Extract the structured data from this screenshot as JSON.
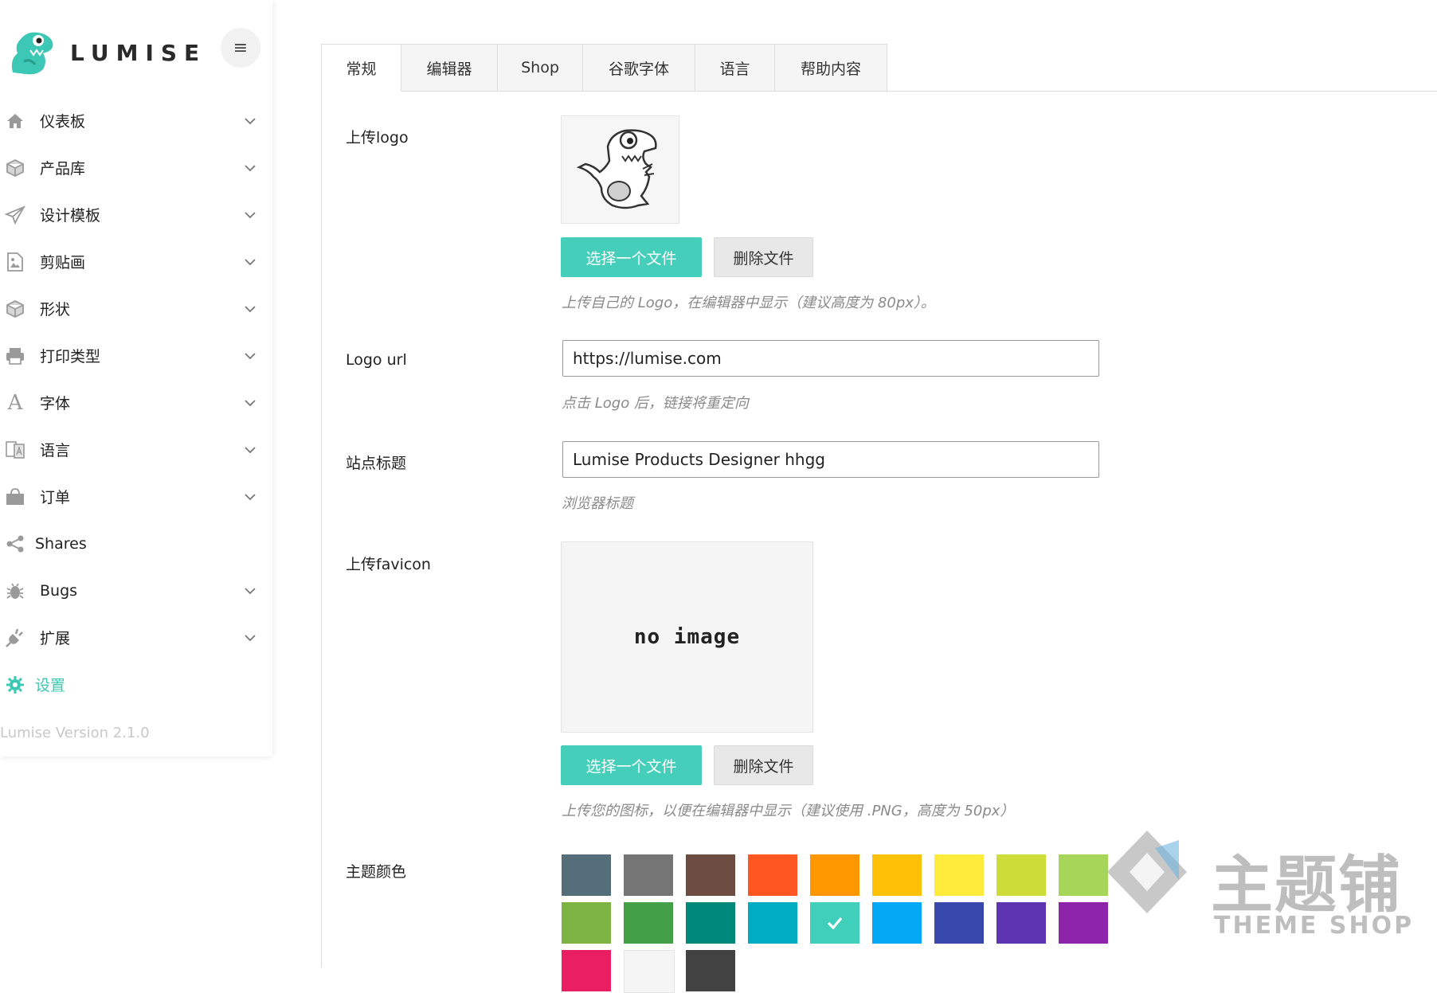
{
  "brand": {
    "name": "LUMISE"
  },
  "sidebar": {
    "items": [
      {
        "label": "仪表板",
        "icon": "home-icon",
        "chevron": true
      },
      {
        "label": "产品库",
        "icon": "cube-icon",
        "chevron": true
      },
      {
        "label": "设计模板",
        "icon": "paper-plane-icon",
        "chevron": true
      },
      {
        "label": "剪贴画",
        "icon": "image-file-icon",
        "chevron": true
      },
      {
        "label": "形状",
        "icon": "cube-icon",
        "chevron": true
      },
      {
        "label": "打印类型",
        "icon": "printer-icon",
        "chevron": true
      },
      {
        "label": "字体",
        "icon": "font-icon",
        "chevron": true
      },
      {
        "label": "语言",
        "icon": "translate-icon",
        "chevron": true
      },
      {
        "label": "订单",
        "icon": "shopping-bag-icon",
        "chevron": true
      },
      {
        "label": "Shares",
        "icon": "share-icon",
        "chevron": false
      },
      {
        "label": "Bugs",
        "icon": "bug-icon",
        "chevron": true
      },
      {
        "label": "扩展",
        "icon": "plug-icon",
        "chevron": true
      },
      {
        "label": "设置",
        "icon": "gear-icon",
        "chevron": false,
        "active": true
      }
    ],
    "version": "Lumise Version 2.1.0"
  },
  "tabs": [
    "常规",
    "编辑器",
    "Shop",
    "谷歌字体",
    "语言",
    "帮助内容"
  ],
  "form": {
    "upload_logo": {
      "label": "上传logo",
      "choose_label": "选择一个文件",
      "delete_label": "删除文件",
      "hint": "上传自己的 Logo，在编辑器中显示（建议高度为 80px）。"
    },
    "logo_url": {
      "label": "Logo url",
      "value": "https://lumise.com",
      "hint": "点击 Logo 后，链接将重定向"
    },
    "site_title": {
      "label": "站点标题",
      "value": "Lumise Products Designer hhgg",
      "hint": "浏览器标题"
    },
    "upload_favicon": {
      "label": "上传favicon",
      "placeholder_text": "no image",
      "choose_label": "选择一个文件",
      "delete_label": "删除文件",
      "hint": "上传您的图标，以便在编辑器中显示（建议使用 .PNG，高度为 50px）"
    },
    "theme_color": {
      "label": "主题颜色",
      "colors": [
        "#546e7a",
        "#757575",
        "#6d4c41",
        "#ff5722",
        "#ff9800",
        "#ffc107",
        "#ffeb3b",
        "#cddc39",
        "#a5d65a",
        "#7cb342",
        "#43a047",
        "#00897b",
        "#00acc1",
        "#3fcfbb",
        "#03a9f4",
        "#3949ab",
        "#5e35b1",
        "#8e24aa",
        "#e91e63",
        "#f5f5f5",
        "#424242"
      ],
      "selected": "#3fcfbb"
    }
  },
  "watermark": {
    "cn": "主题铺",
    "en": "THEME SHOP"
  },
  "accent": "#45cfba"
}
